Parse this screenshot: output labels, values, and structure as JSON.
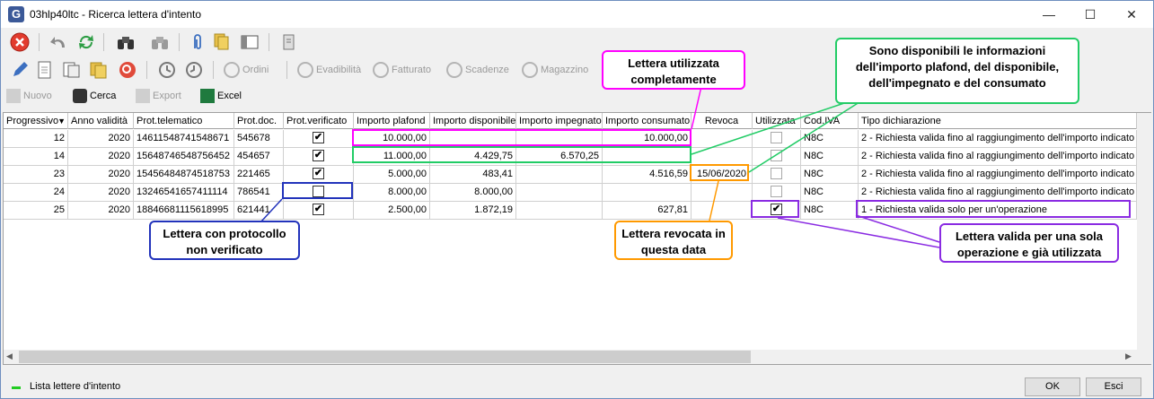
{
  "window": {
    "app_icon_letter": "G",
    "title": "03hlp40ltc - Ricerca lettera d'intento",
    "minimize": "—",
    "maximize": "☐",
    "close": "✕"
  },
  "toolbar2": {
    "ordini": "Ordini",
    "evadibilita": "Evadibilità",
    "fatturato": "Fatturato",
    "scadenze": "Scadenze",
    "magazzino": "Magazzino"
  },
  "toolbar3": {
    "nuovo": "Nuovo",
    "cerca": "Cerca",
    "export": "Export",
    "excel": "Excel"
  },
  "grid": {
    "columns": [
      "Progressivo",
      "Anno validità",
      "Prot.telematico",
      "Prot.doc.",
      "Prot.verificato",
      "Importo plafond",
      "Importo disponibile",
      "Importo impegnato",
      "Importo consumato",
      "Revoca",
      "Utilizzata",
      "Cod.IVA",
      "Tipo dichiarazione"
    ],
    "sort_indicator": "▼",
    "rows": [
      {
        "progressivo": "12",
        "anno": "2020",
        "prot_telematico": "14611548741548671",
        "prot_doc": "545678",
        "verificato": true,
        "plafond": "10.000,00",
        "disponibile": "",
        "impegnato": "",
        "consumato": "10.000,00",
        "revoca": "",
        "utilizzata": false,
        "cod_iva": "N8C",
        "tipo": "2 - Richiesta valida fino al raggiungimento dell'importo indicato"
      },
      {
        "progressivo": "14",
        "anno": "2020",
        "prot_telematico": "15648746548756452",
        "prot_doc": "454657",
        "verificato": true,
        "plafond": "11.000,00",
        "disponibile": "4.429,75",
        "impegnato": "6.570,25",
        "consumato": "",
        "revoca": "",
        "utilizzata": false,
        "cod_iva": "N8C",
        "tipo": "2 - Richiesta valida fino al raggiungimento dell'importo indicato"
      },
      {
        "progressivo": "23",
        "anno": "2020",
        "prot_telematico": "15456484874518753",
        "prot_doc": "221465",
        "verificato": true,
        "plafond": "5.000,00",
        "disponibile": "483,41",
        "impegnato": "",
        "consumato": "4.516,59",
        "revoca": "15/06/2020",
        "utilizzata": false,
        "cod_iva": "N8C",
        "tipo": "2 - Richiesta valida fino al raggiungimento dell'importo indicato"
      },
      {
        "progressivo": "24",
        "anno": "2020",
        "prot_telematico": "13246541657411114",
        "prot_doc": "786541",
        "verificato": false,
        "plafond": "8.000,00",
        "disponibile": "8.000,00",
        "impegnato": "",
        "consumato": "",
        "revoca": "",
        "utilizzata": false,
        "cod_iva": "N8C",
        "tipo": "2 - Richiesta valida fino al raggiungimento dell'importo indicato"
      },
      {
        "progressivo": "25",
        "anno": "2020",
        "prot_telematico": "18846681115618995",
        "prot_doc": "621441",
        "verificato": true,
        "plafond": "2.500,00",
        "disponibile": "1.872,19",
        "impegnato": "",
        "consumato": "627,81",
        "revoca": "",
        "utilizzata": true,
        "cod_iva": "N8C",
        "tipo": "1 - Richiesta valida solo per un'operazione"
      }
    ]
  },
  "status": {
    "legend": "Lista lettere d'intento",
    "ok": "OK",
    "esci": "Esci"
  },
  "callouts": {
    "utilizzata": "Lettera utilizzata completamente",
    "informazioni": "Sono disponibili le informazioni dell'importo plafond, del disponibile, dell'impegnato e del consumato",
    "non_verificato": "Lettera con protocollo non verificato",
    "revocata": "Lettera revocata in questa data",
    "sola_operazione": "Lettera valida per una sola operazione e già utilizzata"
  },
  "colors": {
    "magenta": "#ff00ff",
    "green": "#22cc66",
    "blue": "#2233bb",
    "orange": "#ff9900",
    "purple": "#8a2be2"
  }
}
